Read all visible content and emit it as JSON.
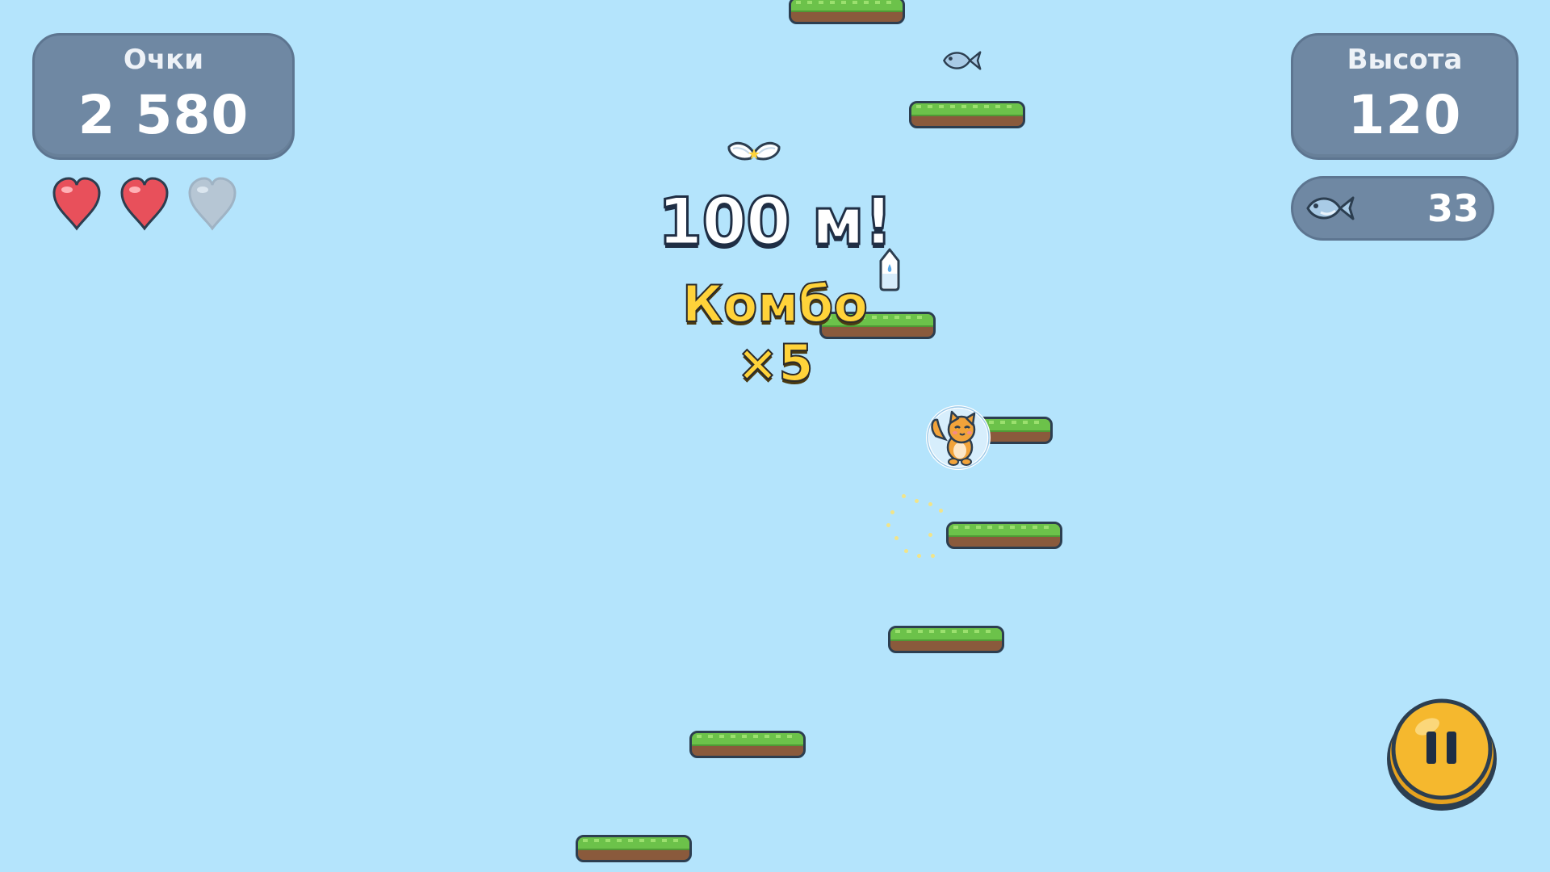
{
  "hud": {
    "score_label": "Очки",
    "score_value": "2 580",
    "height_label": "Высота",
    "height_value": "120",
    "fish_count": "33",
    "lives": {
      "total": 3,
      "remaining": 2
    }
  },
  "popups": {
    "milestone": "100 м!",
    "combo": "Комбо ×5"
  },
  "icons": {
    "pause": "pause-icon",
    "heart": "heart-icon",
    "fish": "fish-icon",
    "wings": "wings-powerup-icon",
    "milk": "milk-bottle-icon",
    "cat": "cat-player"
  },
  "colors": {
    "sky": "#b4e4fc",
    "panel": "#6f88a3",
    "heart_full": "#e8505b",
    "heart_empty": "#b6c6d4",
    "grass": "#6cc24a",
    "dirt": "#8a5a3c",
    "pause_button": "#f5b82e",
    "combo_text": "#ffd33a"
  }
}
